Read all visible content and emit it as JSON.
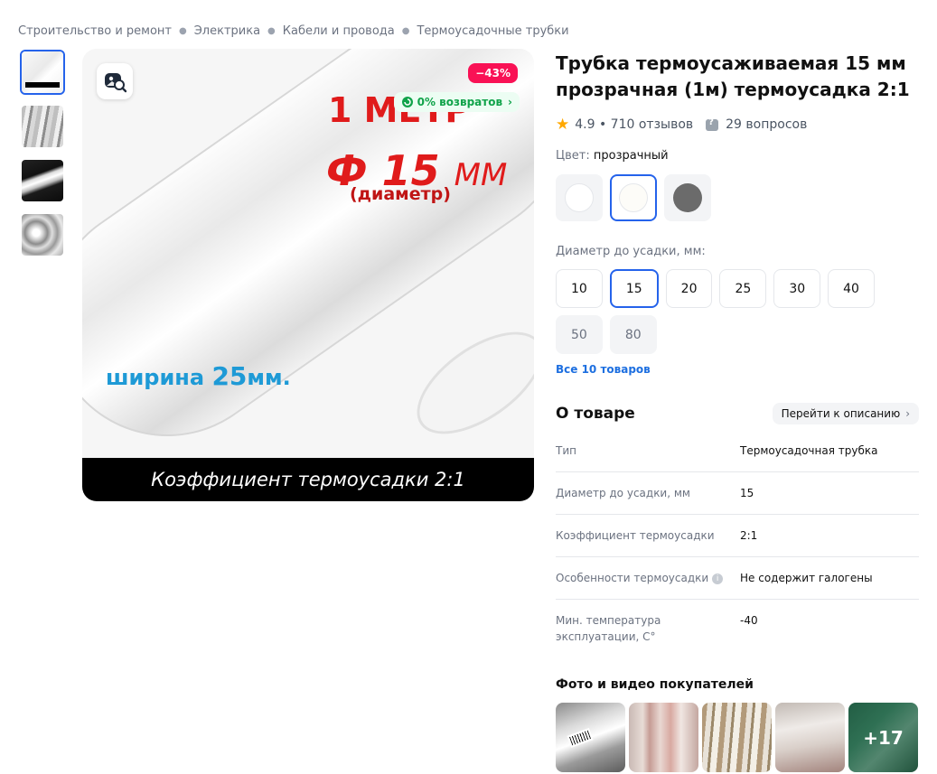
{
  "breadcrumb": [
    "Строительство и ремонт",
    "Электрика",
    "Кабели и провода",
    "Термоусадочные трубки"
  ],
  "gallery": {
    "thumbnails": [
      "thumb-1",
      "thumb-2",
      "thumb-3",
      "thumb-4"
    ],
    "discount": "−43%",
    "returns": "0% возвратов",
    "image_text": {
      "line1": "1 МЕТР",
      "line2_prefix": "Ф 15",
      "line2_unit": "ММ",
      "line3": "(диаметр)",
      "width_prefix": "ширина",
      "width_value": "25",
      "width_unit": "мм.",
      "caption": "Коэффициент термоусадки 2:1"
    }
  },
  "product": {
    "title": "Трубка термоусаживаемая 15 мм прозрачная (1м) термоусадка 2:1",
    "rating": "4.9",
    "reviews": "• 710 отзывов",
    "questions": "29 вопросов"
  },
  "color": {
    "label": "Цвет:",
    "value": "прозрачный",
    "swatches": [
      "#ffffff",
      "#fdfcf8",
      "#6b6b6b"
    ]
  },
  "diameter": {
    "label": "Диаметр до усадки, мм:",
    "options": [
      "10",
      "15",
      "20",
      "25",
      "30",
      "40",
      "50",
      "80"
    ],
    "selected": "15",
    "disabled": [
      "50",
      "80"
    ],
    "all_link": "Все 10 товаров"
  },
  "about": {
    "title": "О товаре",
    "goto": "Перейти к описанию",
    "specs": [
      {
        "key": "Тип",
        "value": "Термоусадочная трубка"
      },
      {
        "key": "Диаметр до усадки, мм",
        "value": "15"
      },
      {
        "key": "Коэффициент термоусадки",
        "value": "2:1"
      },
      {
        "key": "Особенности термоусадки",
        "value": "Не содержит галогены"
      },
      {
        "key": "Мин. температура эксплуатации, С°",
        "value": "-40"
      }
    ]
  },
  "photos": {
    "title": "Фото и видео покупателей",
    "more": "+17"
  }
}
